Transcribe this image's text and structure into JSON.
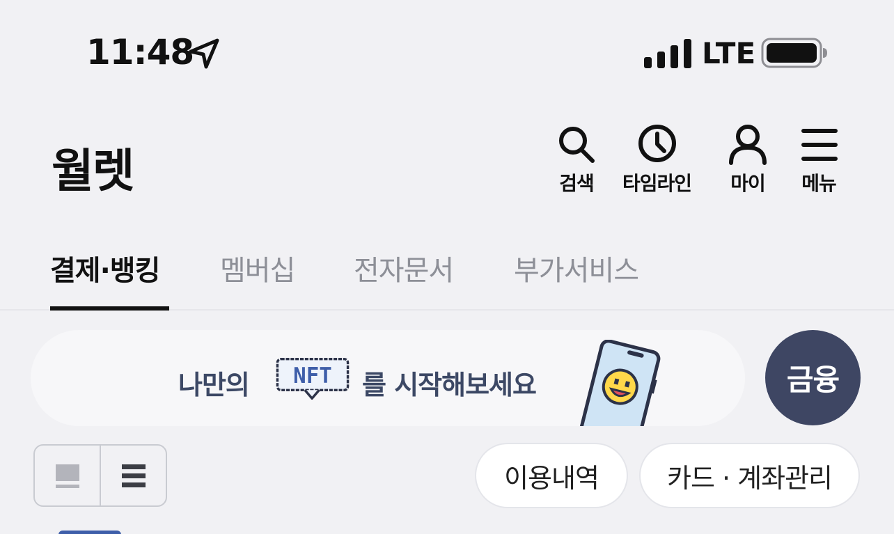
{
  "status": {
    "time": "11:48",
    "network": "LTE"
  },
  "header": {
    "title": "월렛",
    "actions": [
      {
        "label": "검색",
        "icon": "search-icon"
      },
      {
        "label": "타임라인",
        "icon": "clock-icon"
      },
      {
        "label": "마이",
        "icon": "person-icon"
      },
      {
        "label": "메뉴",
        "icon": "hamburger-icon"
      }
    ]
  },
  "tabs": [
    {
      "label": "결제·뱅킹",
      "active": true
    },
    {
      "label": "멤버십",
      "active": false
    },
    {
      "label": "전자문서",
      "active": false
    },
    {
      "label": "부가서비스",
      "active": false
    }
  ],
  "banner": {
    "text_before": "나만의",
    "tag": "NFT",
    "text_after": "를 시작해보세요"
  },
  "finance_button": "금융",
  "view_options": [
    "card-view-icon",
    "list-view-icon"
  ],
  "actions": {
    "history": "이용내역",
    "manage": "카드 · 계좌관리"
  },
  "colors": {
    "background": "#f1f1f4",
    "accent_dark": "#3e4663",
    "banner_text": "#3c4865",
    "nft_blue": "#3e5ea9",
    "tab_inactive": "#8d8f97"
  }
}
